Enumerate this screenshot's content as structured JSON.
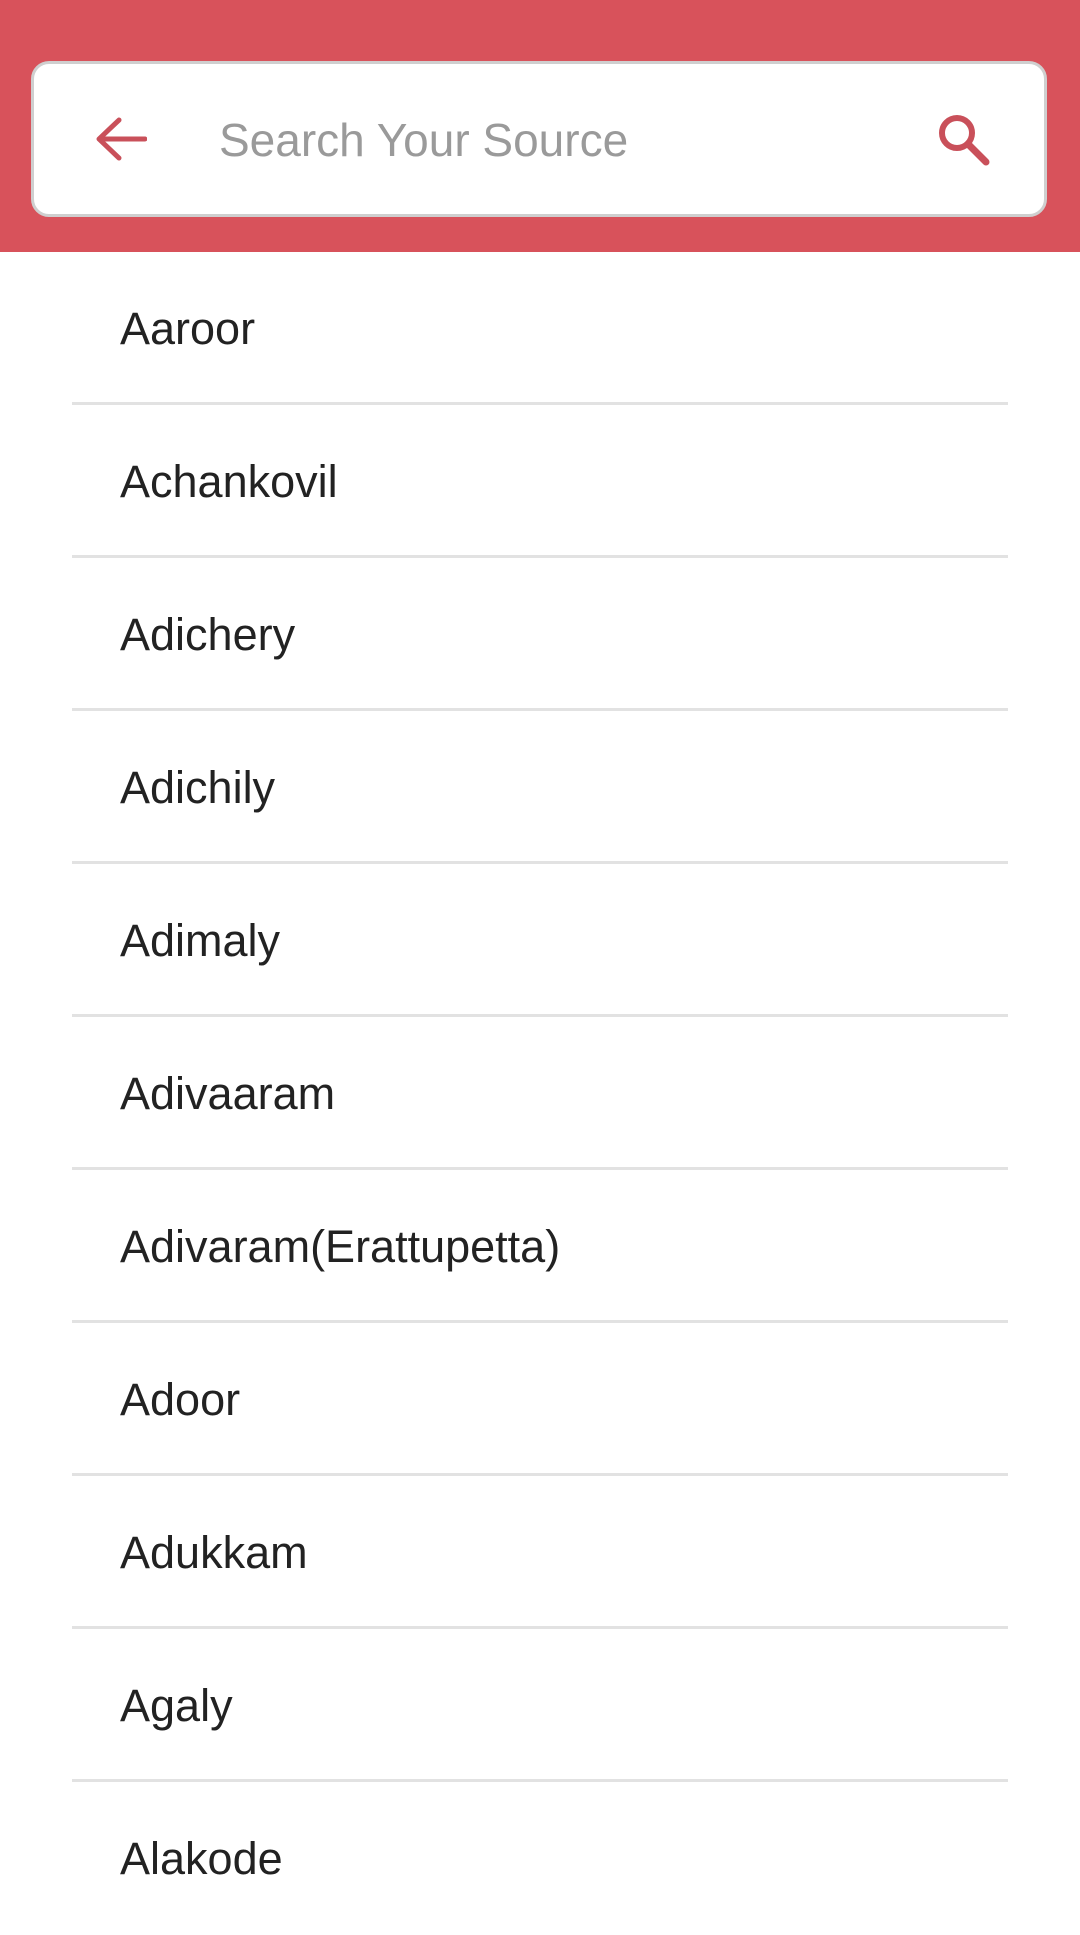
{
  "colors": {
    "header_bg": "#d8525b",
    "accent": "#c9505a",
    "text": "#222222",
    "placeholder": "#9a9a9a",
    "divider": "#e2e2e2"
  },
  "header": {
    "back_icon": "arrow-left-icon",
    "search_icon": "search-icon",
    "search": {
      "value": "",
      "placeholder": "Search Your Source"
    }
  },
  "sources": [
    {
      "label": "Aaroor"
    },
    {
      "label": "Achankovil"
    },
    {
      "label": "Adichery"
    },
    {
      "label": "Adichily"
    },
    {
      "label": "Adimaly"
    },
    {
      "label": "Adivaaram"
    },
    {
      "label": "Adivaram(Erattupetta)"
    },
    {
      "label": "Adoor"
    },
    {
      "label": "Adukkam"
    },
    {
      "label": "Agaly"
    },
    {
      "label": "Alakode"
    }
  ]
}
